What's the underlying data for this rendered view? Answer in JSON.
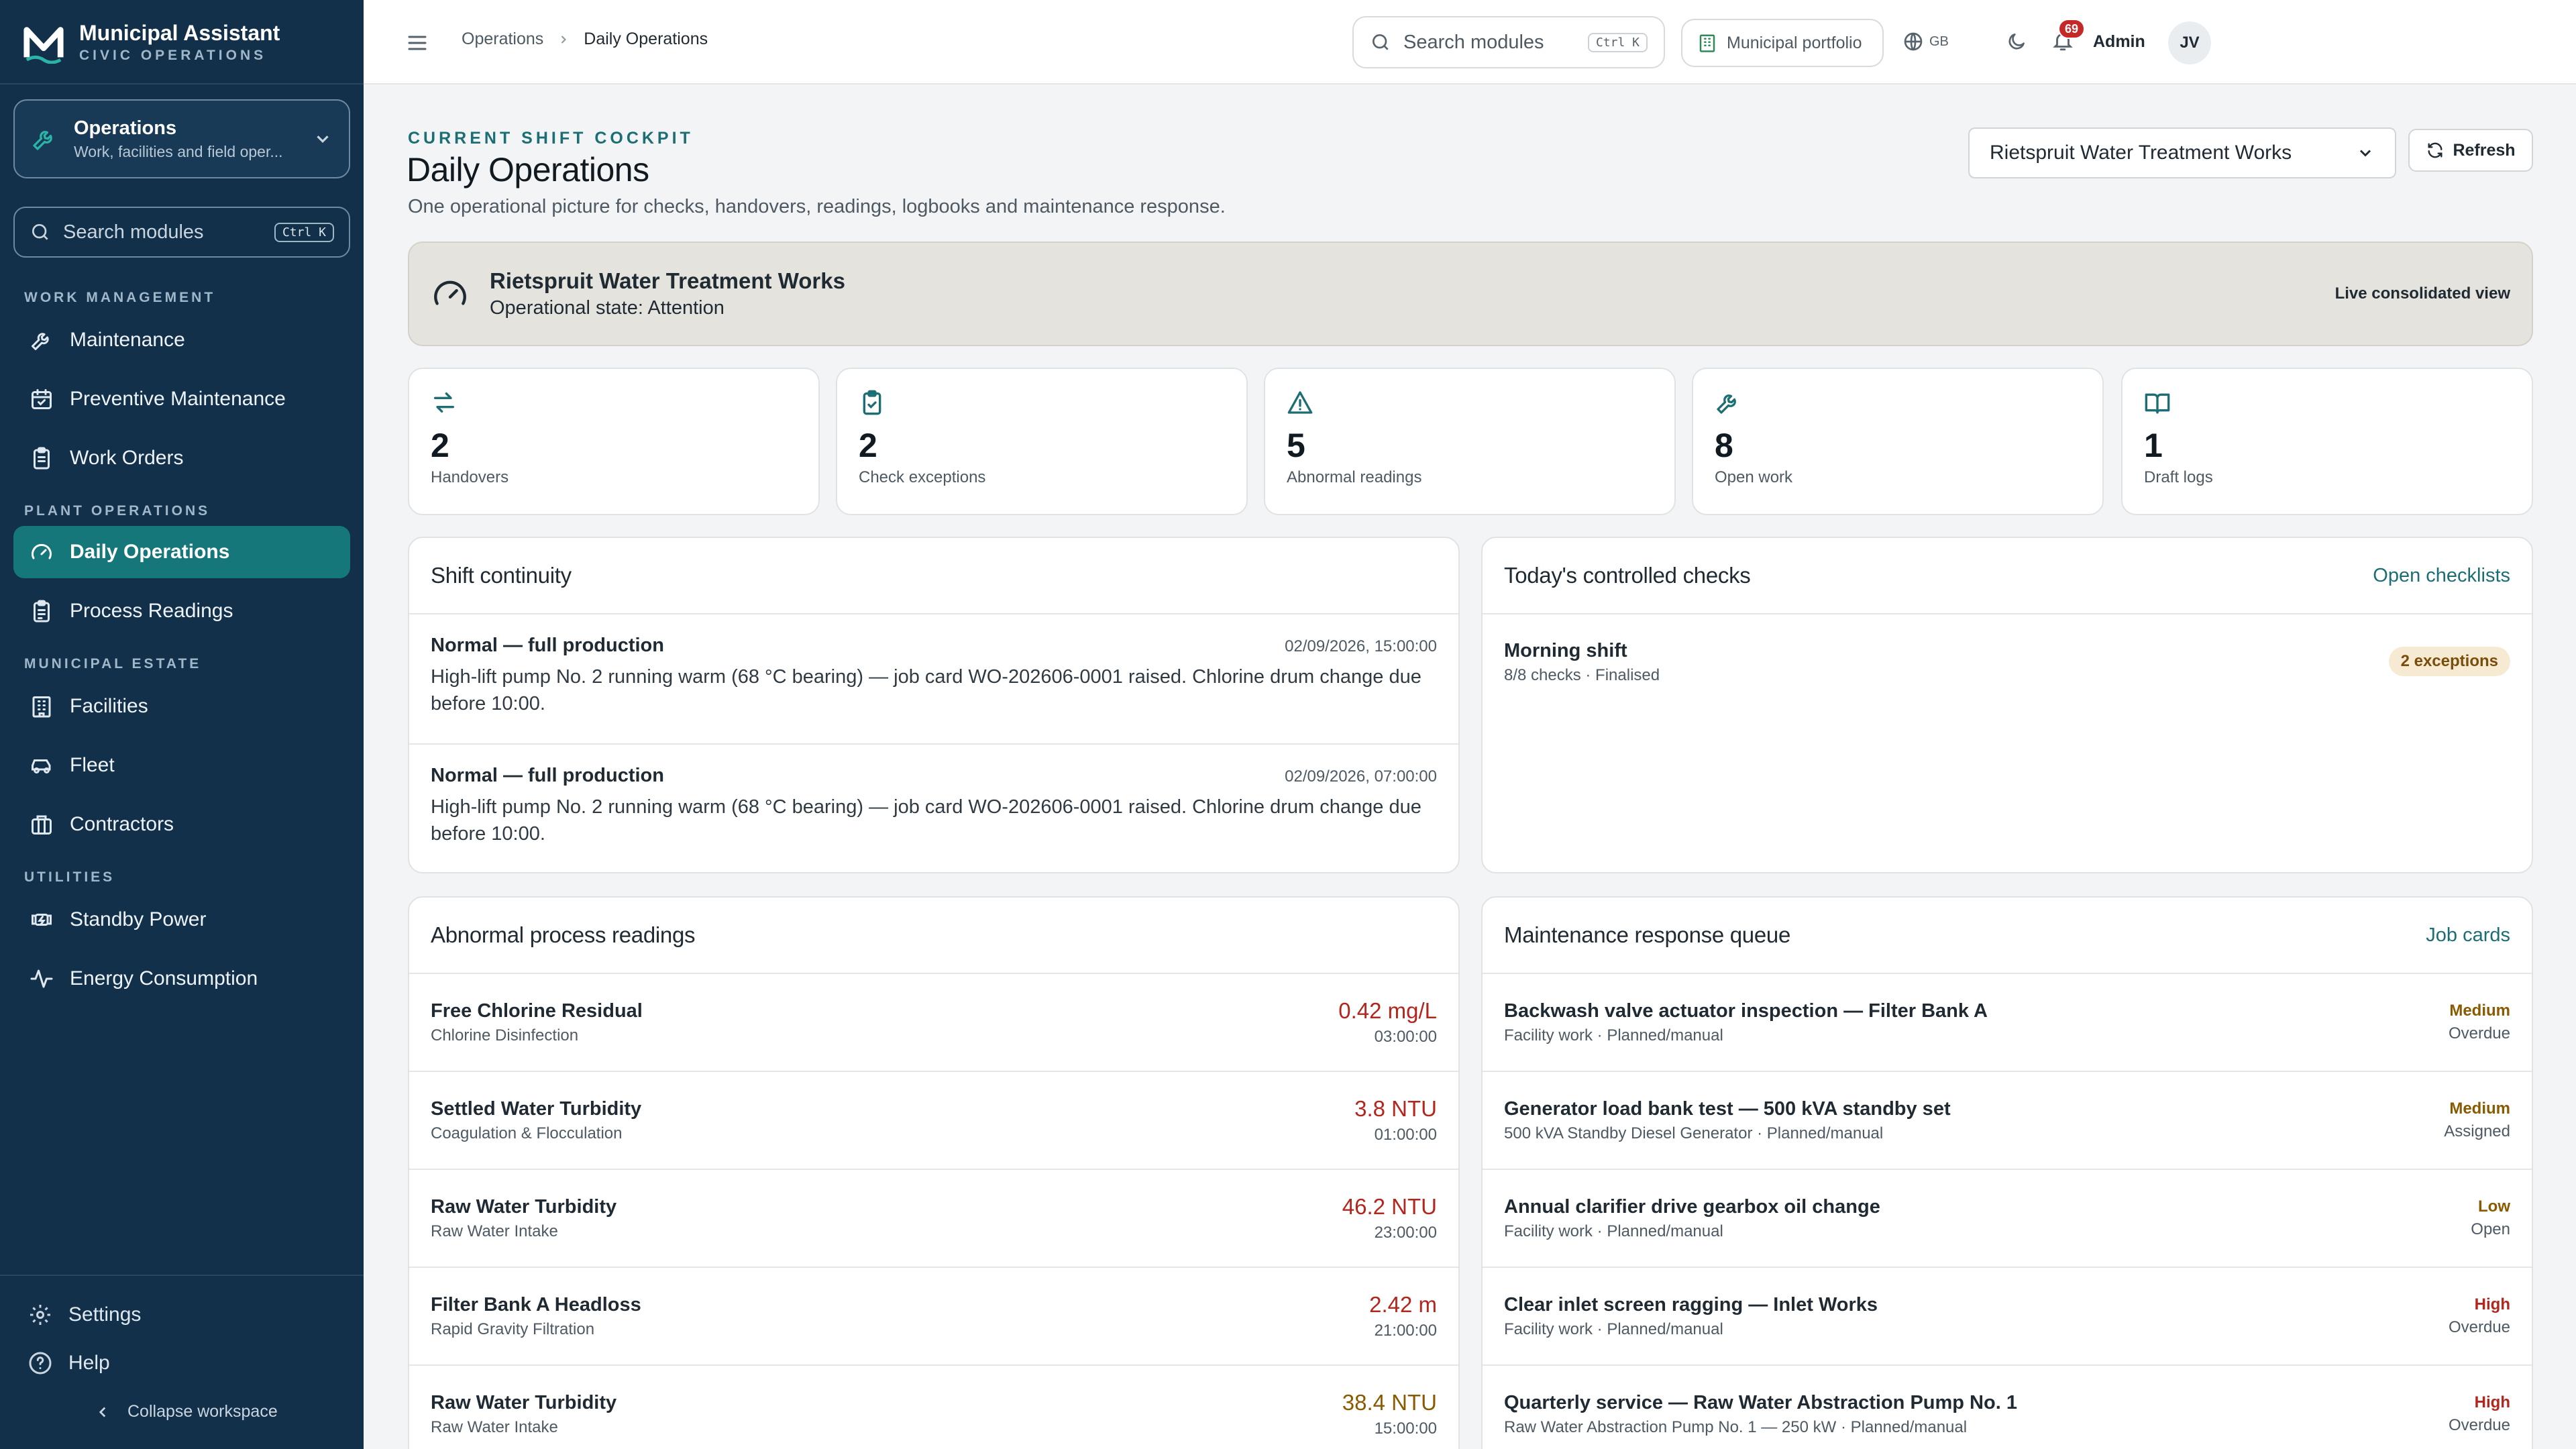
{
  "brand": {
    "title": "Municipal Assistant",
    "subtitle": "CIVIC OPERATIONS"
  },
  "workspace": {
    "title": "Operations",
    "subtitle": "Work, facilities and field oper..."
  },
  "sidebar_search": {
    "placeholder": "Search modules",
    "shortcut": "Ctrl K"
  },
  "sidebar": {
    "groups": [
      {
        "label": "WORK MANAGEMENT",
        "items": [
          {
            "label": "Maintenance",
            "icon": "wrench-icon"
          },
          {
            "label": "Preventive Maintenance",
            "icon": "calendar-check-icon"
          },
          {
            "label": "Work Orders",
            "icon": "clipboard-icon"
          }
        ]
      },
      {
        "label": "PLANT OPERATIONS",
        "items": [
          {
            "label": "Daily Operations",
            "icon": "gauge-icon",
            "active": true
          },
          {
            "label": "Process Readings",
            "icon": "clipboard-list-icon"
          }
        ]
      },
      {
        "label": "MUNICIPAL ESTATE",
        "items": [
          {
            "label": "Facilities",
            "icon": "building-icon"
          },
          {
            "label": "Fleet",
            "icon": "car-icon"
          },
          {
            "label": "Contractors",
            "icon": "briefcase-icon"
          }
        ]
      },
      {
        "label": "UTILITIES",
        "items": [
          {
            "label": "Standby Power",
            "icon": "generator-icon"
          },
          {
            "label": "Energy Consumption",
            "icon": "activity-icon"
          }
        ]
      }
    ],
    "footer": {
      "settings": "Settings",
      "help": "Help",
      "collapse": "Collapse workspace"
    }
  },
  "topbar": {
    "breadcrumbs": [
      "Operations",
      "Daily Operations"
    ],
    "search_placeholder": "Search modules",
    "search_shortcut": "Ctrl K",
    "portfolio": "Municipal portfolio",
    "language": "GB",
    "notification_count": "69",
    "user_label": "Admin",
    "avatar_initials": "JV"
  },
  "header": {
    "eyebrow": "CURRENT SHIFT COCKPIT",
    "title": "Daily Operations",
    "subtitle": "One operational picture for checks, handovers, readings, logbooks and maintenance response.",
    "site": "Rietspruit Water Treatment Works",
    "refresh": "Refresh"
  },
  "banner": {
    "title": "Rietspruit Water Treatment Works",
    "state": "Operational state: Attention",
    "right": "Live consolidated view"
  },
  "stats": [
    {
      "value": "2",
      "label": "Handovers",
      "icon": "arrows-swap-icon"
    },
    {
      "value": "2",
      "label": "Check exceptions",
      "icon": "clipboard-check-icon"
    },
    {
      "value": "5",
      "label": "Abnormal readings",
      "icon": "warning-icon"
    },
    {
      "value": "8",
      "label": "Open work",
      "icon": "wrench-icon"
    },
    {
      "value": "1",
      "label": "Draft logs",
      "icon": "book-icon"
    }
  ],
  "shift_continuity": {
    "title": "Shift continuity",
    "entries": [
      {
        "title": "Normal — full production",
        "time": "02/09/2026, 15:00:00",
        "note": "High-lift pump No. 2 running warm (68 °C bearing) — job card WO-202606-0001 raised. Chlorine drum change due before 10:00."
      },
      {
        "title": "Normal — full production",
        "time": "02/09/2026, 07:00:00",
        "note": "High-lift pump No. 2 running warm (68 °C bearing) — job card WO-202606-0001 raised. Chlorine drum change due before 10:00."
      }
    ]
  },
  "checks": {
    "title": "Today's controlled checks",
    "link": "Open checklists",
    "items": [
      {
        "title": "Morning shift",
        "sub": "8/8 checks · Finalised",
        "badge": "2 exceptions"
      }
    ]
  },
  "readings": {
    "title": "Abnormal process readings",
    "rows": [
      {
        "name": "Free Chlorine Residual",
        "unit_area": "Chlorine Disinfection",
        "value": "0.42 mg/L",
        "time": "03:00:00",
        "color": "#b3261e"
      },
      {
        "name": "Settled Water Turbidity",
        "unit_area": "Coagulation & Flocculation",
        "value": "3.8 NTU",
        "time": "01:00:00",
        "color": "#b3261e"
      },
      {
        "name": "Raw Water Turbidity",
        "unit_area": "Raw Water Intake",
        "value": "46.2 NTU",
        "time": "23:00:00",
        "color": "#b3261e"
      },
      {
        "name": "Filter Bank A Headloss",
        "unit_area": "Rapid Gravity Filtration",
        "value": "2.42 m",
        "time": "21:00:00",
        "color": "#b3261e"
      },
      {
        "name": "Raw Water Turbidity",
        "unit_area": "Raw Water Intake",
        "value": "38.4 NTU",
        "time": "15:00:00",
        "color": "#8a5a00"
      }
    ]
  },
  "maintenance": {
    "title": "Maintenance response queue",
    "link": "Job cards",
    "rows": [
      {
        "title": "Backwash valve actuator inspection — Filter Bank A",
        "sub": "Facility work · Planned/manual",
        "priority": "Medium",
        "status": "Overdue",
        "color": "#8a5a00"
      },
      {
        "title": "Generator load bank test — 500 kVA standby set",
        "sub": "500 kVA Standby Diesel Generator · Planned/manual",
        "priority": "Medium",
        "status": "Assigned",
        "color": "#8a5a00"
      },
      {
        "title": "Annual clarifier drive gearbox oil change",
        "sub": "Facility work · Planned/manual",
        "priority": "Low",
        "status": "Open",
        "color": "#8a5a00"
      },
      {
        "title": "Clear inlet screen ragging — Inlet Works",
        "sub": "Facility work · Planned/manual",
        "priority": "High",
        "status": "Overdue",
        "color": "#b3261e"
      },
      {
        "title": "Quarterly service — Raw Water Abstraction Pump No. 1",
        "sub": "Raw Water Abstraction Pump No. 1 — 250 kW · Planned/manual",
        "priority": "High",
        "status": "Overdue",
        "color": "#b3261e"
      }
    ]
  }
}
